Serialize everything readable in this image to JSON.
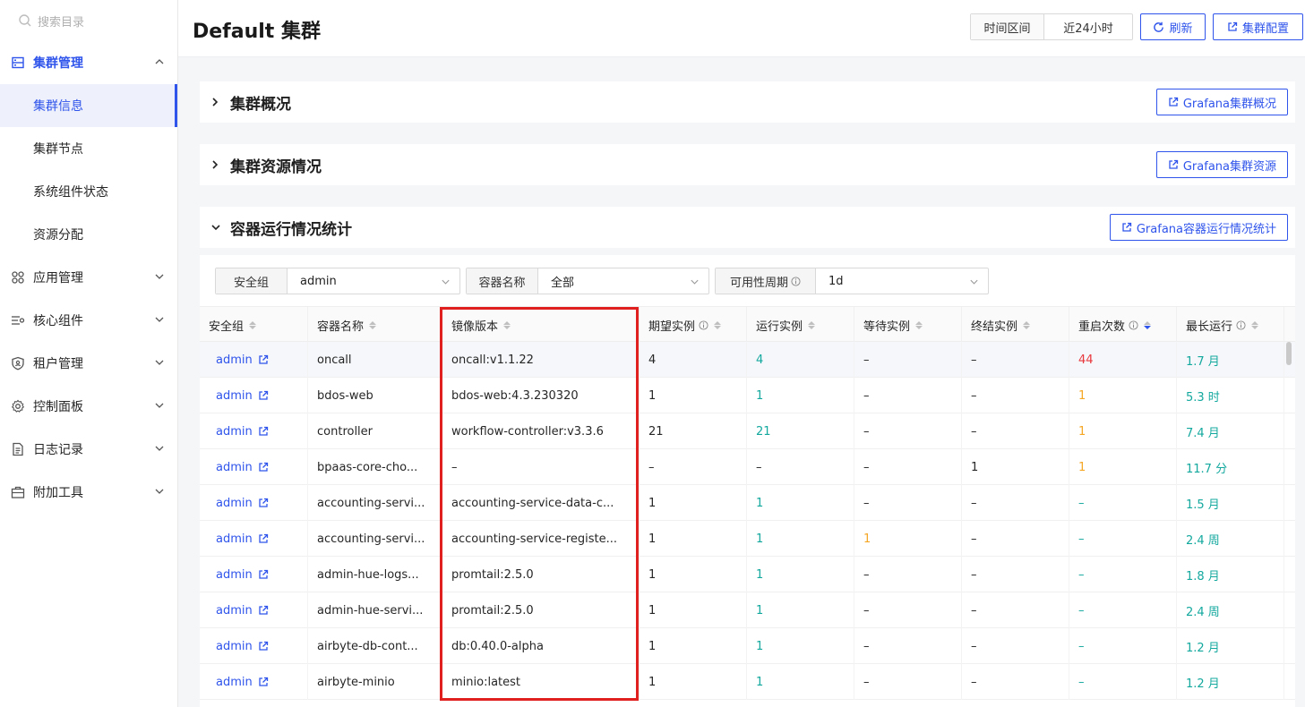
{
  "sidebar": {
    "search_placeholder": "搜索目录",
    "menu": [
      {
        "label": "集群管理",
        "icon": "server-icon"
      },
      {
        "label": "应用管理",
        "icon": "apps-icon"
      },
      {
        "label": "核心组件",
        "icon": "components-icon"
      },
      {
        "label": "租户管理",
        "icon": "tenant-icon"
      },
      {
        "label": "控制面板",
        "icon": "gear-icon"
      },
      {
        "label": "日志记录",
        "icon": "log-icon"
      },
      {
        "label": "附加工具",
        "icon": "toolbox-icon"
      }
    ],
    "cluster_sub": [
      "集群信息",
      "集群节点",
      "系统组件状态",
      "资源分配"
    ]
  },
  "header": {
    "title": "Default 集群",
    "time_label": "时间区间",
    "time_value": "近24小时",
    "refresh": "刷新",
    "config": "集群配置"
  },
  "panels": {
    "overview": {
      "title": "集群概况",
      "button": "Grafana集群概况"
    },
    "resource": {
      "title": "集群资源情况",
      "button": "Grafana集群资源"
    },
    "container": {
      "title": "容器运行情况统计",
      "button": "Grafana容器运行情况统计"
    }
  },
  "filters": {
    "security_group": {
      "label": "安全组",
      "value": "admin"
    },
    "container_name": {
      "label": "容器名称",
      "value": "全部"
    },
    "availability": {
      "label": "可用性周期",
      "value": "1d"
    }
  },
  "table": {
    "columns": [
      "安全组",
      "容器名称",
      "镜像版本",
      "期望实例",
      "运行实例",
      "等待实例",
      "终结实例",
      "重启次数",
      "最长运行"
    ],
    "rows": [
      [
        "admin",
        "oncall",
        "oncall:v1.1.22",
        "4",
        "4",
        "–",
        "–",
        "44",
        "1.7 月"
      ],
      [
        "admin",
        "bdos-web",
        "bdos-web:4.3.230320",
        "1",
        "1",
        "–",
        "–",
        "1",
        "5.3 时"
      ],
      [
        "admin",
        "controller",
        "workflow-controller:v3.3.6",
        "21",
        "21",
        "–",
        "–",
        "1",
        "7.4 月"
      ],
      [
        "admin",
        "bpaas-core-cho...",
        "–",
        "–",
        "–",
        "–",
        "1",
        "1",
        "11.7 分"
      ],
      [
        "admin",
        "accounting-servi...",
        "accounting-service-data-c...",
        "1",
        "1",
        "–",
        "–",
        "–",
        "1.5 月"
      ],
      [
        "admin",
        "accounting-servi...",
        "accounting-service-registe...",
        "1",
        "1",
        "1",
        "–",
        "–",
        "2.4 周"
      ],
      [
        "admin",
        "admin-hue-logs...",
        "promtail:2.5.0",
        "1",
        "1",
        "–",
        "–",
        "–",
        "1.8 月"
      ],
      [
        "admin",
        "admin-hue-servi...",
        "promtail:2.5.0",
        "1",
        "1",
        "–",
        "–",
        "–",
        "2.4 周"
      ],
      [
        "admin",
        "airbyte-db-cont...",
        "db:0.40.0-alpha",
        "1",
        "1",
        "–",
        "–",
        "–",
        "1.2 月"
      ],
      [
        "admin",
        "airbyte-minio",
        "minio:latest",
        "1",
        "1",
        "–",
        "–",
        "–",
        "1.2 月"
      ]
    ]
  },
  "colors": {
    "accent": "#2f54eb",
    "running": "#13a89e",
    "restart_high": "#e8383d",
    "restart_low": "#f5a623",
    "highlight_box": "#e0201e"
  }
}
